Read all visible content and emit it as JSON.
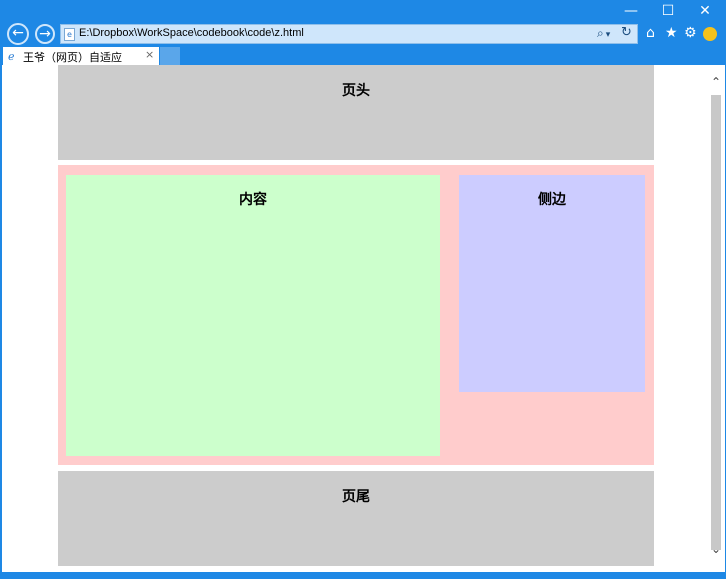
{
  "window": {
    "minimize": "—",
    "maximize": "☐",
    "close": "✕"
  },
  "nav": {
    "back": "←",
    "forward": "→",
    "url": "E:\\Dropbox\\WorkSpace\\codebook\\code\\z.html",
    "search_icon": "⌕",
    "dropdown_icon": "▾",
    "refresh_icon": "↻"
  },
  "tools": {
    "home": "⌂",
    "favorites": "★",
    "settings": "⚙"
  },
  "tab": {
    "title": "王爷（网页）自适应",
    "close": "×"
  },
  "page": {
    "header": "页头",
    "content": "内容",
    "side": "侧边",
    "footer": "页尾"
  },
  "colors": {
    "chrome": "#1e88e5",
    "header_bg": "#cccccc",
    "main_bg": "#ffcccc",
    "content_bg": "#ccffcc",
    "side_bg": "#ccccff"
  }
}
